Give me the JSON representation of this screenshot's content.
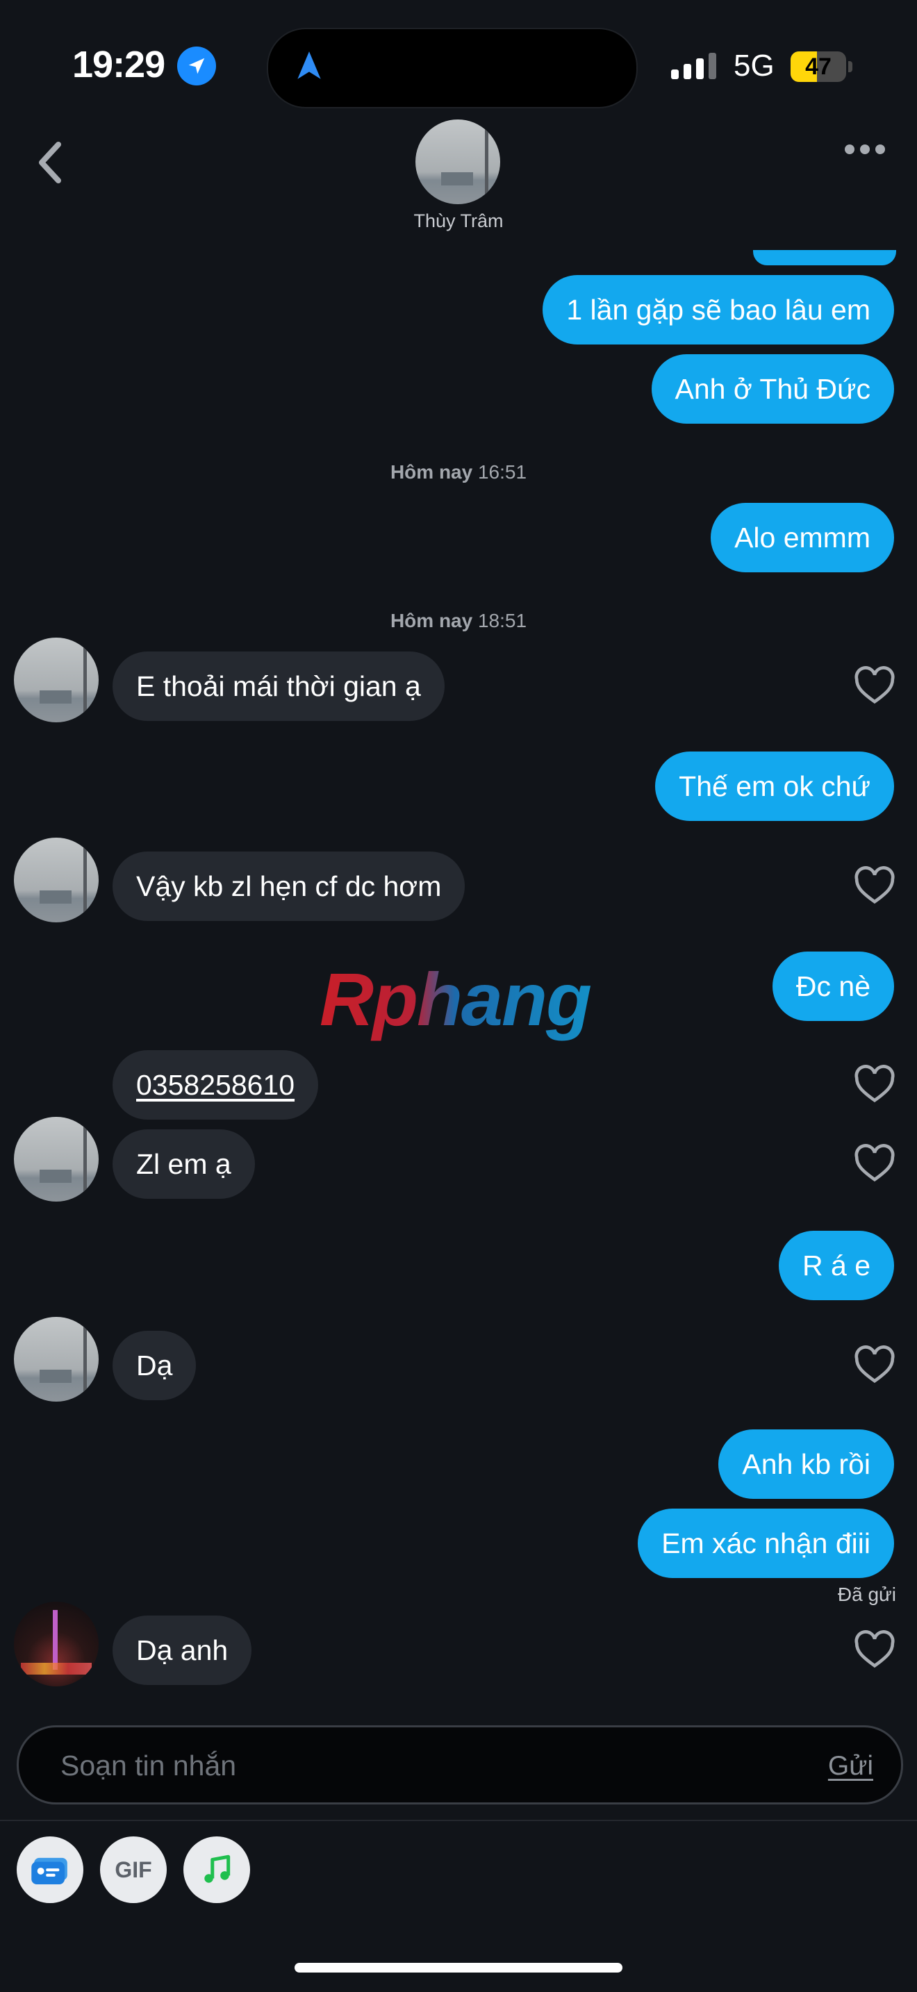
{
  "status_bar": {
    "time": "19:29",
    "network": "5G",
    "battery": "47",
    "battery_level": 0.47
  },
  "header": {
    "contact_name": "Thùy Trâm"
  },
  "timestamps": [
    {
      "day": "Hôm nay",
      "time": "16:51"
    },
    {
      "day": "Hôm nay",
      "time": "18:51"
    }
  ],
  "messages": [
    {
      "dir": "out",
      "text": "1 lần gặp sẽ bao lâu em"
    },
    {
      "dir": "out",
      "text": "Anh ở Thủ Đức"
    },
    {
      "dir": "out",
      "text": "Alo emmm"
    },
    {
      "dir": "in",
      "text": "E thoải mái thời gian ạ"
    },
    {
      "dir": "out",
      "text": "Thế em ok chứ"
    },
    {
      "dir": "in",
      "text": "Vậy kb zl hẹn cf dc hơm"
    },
    {
      "dir": "out",
      "text": "Đc nè"
    },
    {
      "dir": "in",
      "text": "0358258610"
    },
    {
      "dir": "in",
      "text": "Zl em ạ"
    },
    {
      "dir": "out",
      "text": "R á e"
    },
    {
      "dir": "in",
      "text": "Dạ"
    },
    {
      "dir": "out",
      "text": "Anh kb rồi"
    },
    {
      "dir": "out",
      "text": "Em xác nhận điii"
    },
    {
      "dir": "in",
      "text": "Dạ anh"
    }
  ],
  "sent_status": "Đã gửi",
  "watermark": "Rphang",
  "composer": {
    "placeholder": "Soạn tin nhắn",
    "send_label": "Gửi"
  },
  "toolbar": {
    "gif_label": "GIF"
  },
  "colors": {
    "outgoing_bubble": "#13a8ee",
    "incoming_bubble": "#252930",
    "background": "#111419"
  }
}
